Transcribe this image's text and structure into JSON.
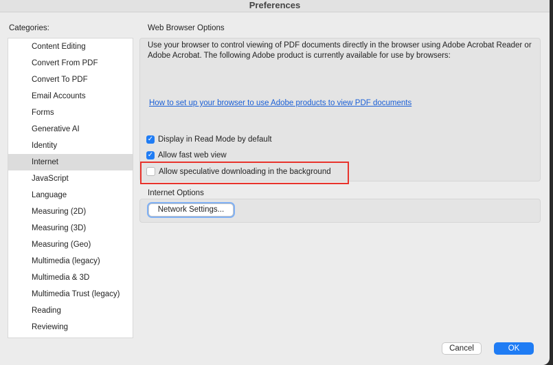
{
  "title": "Preferences",
  "categories_label": "Categories:",
  "categories": [
    "Content Editing",
    "Convert From PDF",
    "Convert To PDF",
    "Email Accounts",
    "Forms",
    "Generative AI",
    "Identity",
    "Internet",
    "JavaScript",
    "Language",
    "Measuring (2D)",
    "Measuring (3D)",
    "Measuring (Geo)",
    "Multimedia (legacy)",
    "Multimedia & 3D",
    "Multimedia Trust (legacy)",
    "Reading",
    "Reviewing"
  ],
  "selected": "Internet",
  "web": {
    "heading": "Web Browser Options",
    "desc": "Use your browser to control viewing of PDF documents directly in the browser using Adobe Acrobat Reader or Adobe Acrobat. The following Adobe product is currently available for use by browsers:",
    "link": "How to set up your browser to use Adobe products to view PDF documents",
    "read_mode": "Display in Read Mode by default",
    "fast_web": "Allow fast web view",
    "speculative": "Allow speculative downloading in the background"
  },
  "internet": {
    "heading": "Internet Options",
    "network": "Network Settings..."
  },
  "buttons": {
    "cancel": "Cancel",
    "ok": "OK"
  }
}
